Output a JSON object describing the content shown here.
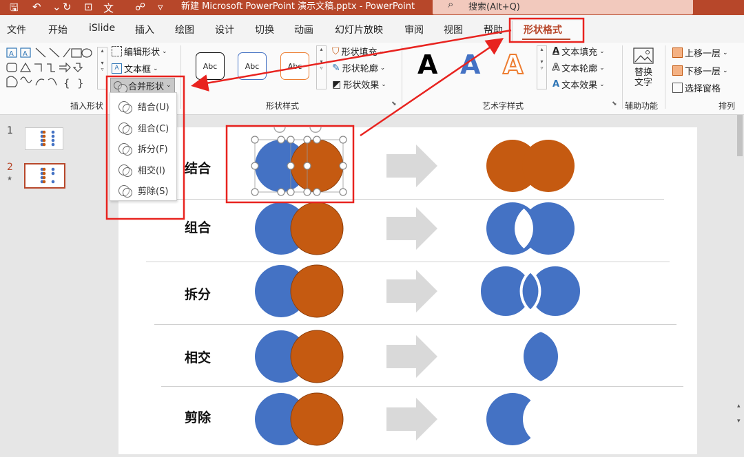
{
  "titlebar": {
    "title": "新建 Microsoft PowerPoint 演示文稿.pptx  -  PowerPoint",
    "search_icon": "search-icon",
    "search_placeholder": "搜索(Alt+Q)",
    "bg": "#b7472a"
  },
  "tabs": [
    "文件",
    "开始",
    "iSlide",
    "插入",
    "绘图",
    "设计",
    "切换",
    "动画",
    "幻灯片放映",
    "审阅",
    "视图",
    "帮助"
  ],
  "active_tab": "形状格式",
  "ribbon": {
    "insert_shapes": {
      "edit_shape": "编辑形状",
      "text_box": "文本框",
      "merge_shapes": "合并形状",
      "label": "插入形状"
    },
    "shape_styles": {
      "samples": [
        "Abc",
        "Abc",
        "Abc"
      ],
      "fill": "形状填充",
      "outline": "形状轮廓",
      "effects": "形状效果",
      "label": "形状样式"
    },
    "wordart": {
      "glyph": "A",
      "text_fill": "文本填充",
      "text_outline": "文本轮廓",
      "text_effects": "文本效果",
      "label": "艺术字样式"
    },
    "accessibility": {
      "alt_text_line1": "替换",
      "alt_text_line2": "文字",
      "label": "辅助功能"
    },
    "arrange": {
      "bring_forward": "上移一层",
      "send_backward": "下移一层",
      "selection_pane": "选择窗格",
      "label": "排列"
    }
  },
  "merge_menu": [
    {
      "label": "结合(U)"
    },
    {
      "label": "组合(C)"
    },
    {
      "label": "拆分(F)"
    },
    {
      "label": "相交(I)"
    },
    {
      "label": "剪除(S)"
    }
  ],
  "thumbnails": [
    {
      "num": "1",
      "selected": false
    },
    {
      "num": "2",
      "selected": true,
      "star": "★"
    }
  ],
  "slide_rows": [
    {
      "label": "结合",
      "result": "union"
    },
    {
      "label": "组合",
      "result": "combine"
    },
    {
      "label": "拆分",
      "result": "fragment"
    },
    {
      "label": "相交",
      "result": "intersect"
    },
    {
      "label": "剪除",
      "result": "subtract"
    }
  ],
  "colors": {
    "blue": "#4472c4",
    "orange": "#c55a11",
    "arrow": "#d9d9d9",
    "annotation_red": "#e8231f",
    "accent": "#b7472a"
  }
}
